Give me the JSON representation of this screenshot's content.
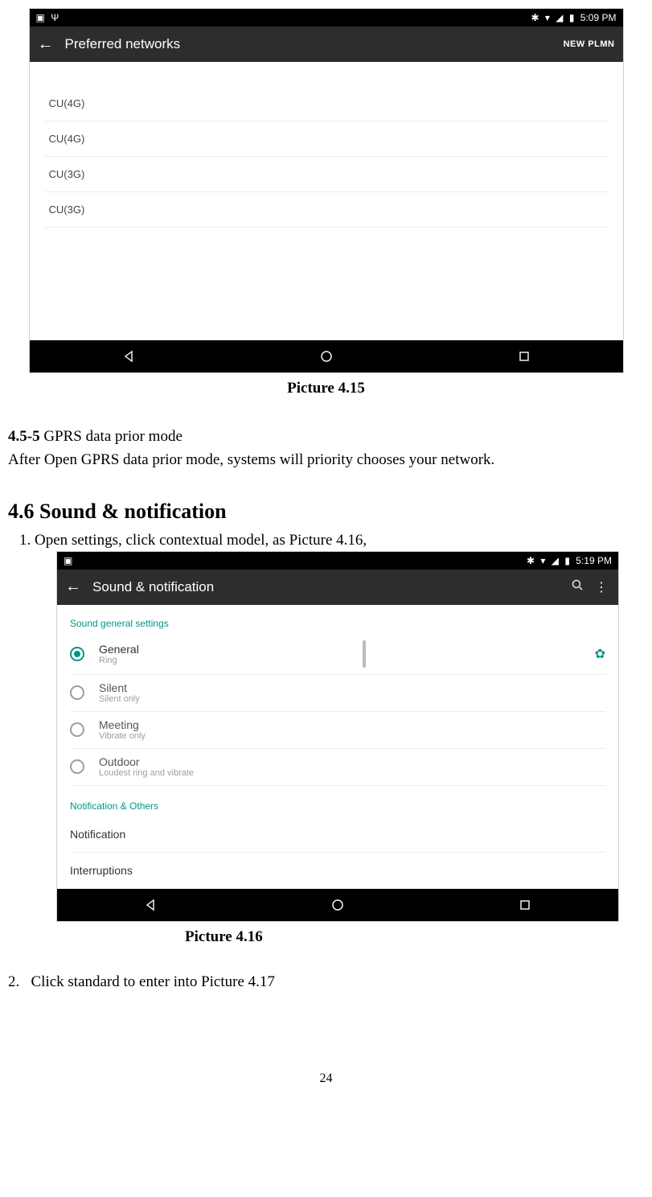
{
  "s1": {
    "status": {
      "time": "5:09 PM"
    },
    "appbar": {
      "title": "Preferred networks",
      "action": "NEW PLMN"
    },
    "rows": [
      "CU(4G)",
      "CU(4G)",
      "CU(3G)",
      "CU(3G)"
    ]
  },
  "caption1": "Picture 4.15",
  "body": {
    "sec_num": "4.5-5",
    "sec_title": " GPRS data prior mode",
    "sec_body": "After Open GPRS data prior mode, systems will priority chooses your network."
  },
  "heading": "4.6 Sound & notification",
  "para1": "1. Open settings, click contextual model, as Picture 4.16,",
  "s2": {
    "status": {
      "time": "5:19 PM"
    },
    "appbar": {
      "title": "Sound & notification"
    },
    "section1": "Sound general settings",
    "options": [
      {
        "t1": "General",
        "t2": "Ring",
        "selected": true
      },
      {
        "t1": "Silent",
        "t2": "Silent only",
        "selected": false
      },
      {
        "t1": "Meeting",
        "t2": "Vibrate only",
        "selected": false
      },
      {
        "t1": "Outdoor",
        "t2": "Loudest ring and vibrate",
        "selected": false
      }
    ],
    "section2": "Notification & Others",
    "rows": [
      "Notification",
      "Interruptions"
    ]
  },
  "caption2": "Picture 4.16",
  "para2_num": "2.",
  "para2_text": "Click standard to enter into Picture 4.17",
  "page_number": "24"
}
